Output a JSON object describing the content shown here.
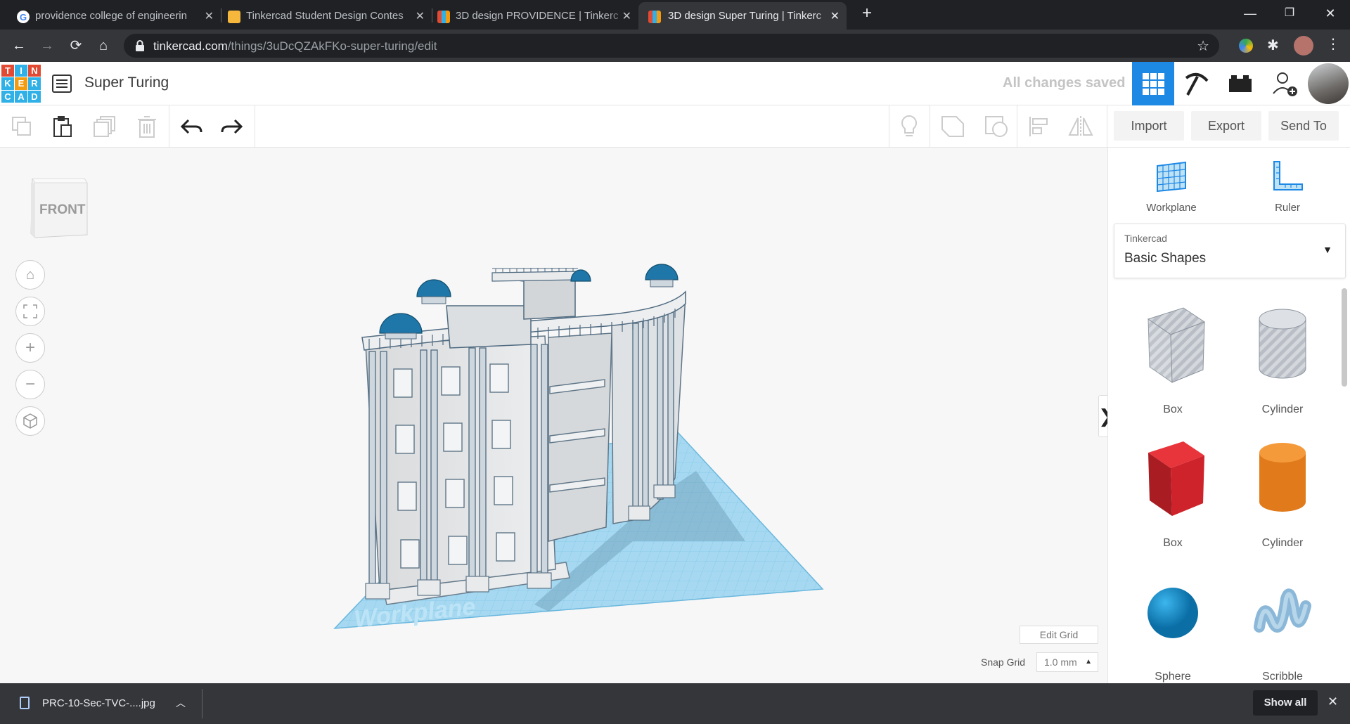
{
  "browser": {
    "tabs": [
      {
        "title": "providence college of engineerin",
        "active": false
      },
      {
        "title": "Tinkercad Student Design Contes",
        "active": false
      },
      {
        "title": "3D design PROVIDENCE | Tinkerc",
        "active": false
      },
      {
        "title": "3D design Super Turing | Tinkerc",
        "active": true
      }
    ],
    "url_host": "tinkercad.com",
    "url_path": "/things/3uDcQZAkFKo-super-turing/edit"
  },
  "header": {
    "logo_letters": [
      "T",
      "I",
      "N",
      "K",
      "E",
      "R",
      "C",
      "A",
      "D"
    ],
    "logo_colors": [
      "#e24a33",
      "#2fb0e6",
      "#e24a33",
      "#2fb0e6",
      "#f39c12",
      "#2fb0e6",
      "#2fb0e6",
      "#2fb0e6",
      "#2fb0e6"
    ],
    "design_title": "Super Turing",
    "save_status": "All changes saved"
  },
  "toolbar": {
    "import_label": "Import",
    "export_label": "Export",
    "sendto_label": "Send To"
  },
  "viewport": {
    "viewcube_label": "FRONT",
    "workplane_watermark": "Workplane",
    "edit_grid_label": "Edit Grid",
    "snap_grid_label": "Snap Grid",
    "snap_grid_value": "1.0 mm"
  },
  "panel": {
    "workplane_label": "Workplane",
    "ruler_label": "Ruler",
    "library_source": "Tinkercad",
    "library_name": "Basic Shapes",
    "shapes": [
      {
        "name": "Box",
        "color": "#b9bec6",
        "kind": "box-hole"
      },
      {
        "name": "Cylinder",
        "color": "#b9bec6",
        "kind": "cyl-hole"
      },
      {
        "name": "Box",
        "color": "#d0262d",
        "kind": "box"
      },
      {
        "name": "Cylinder",
        "color": "#e87c1e",
        "kind": "cyl"
      },
      {
        "name": "Sphere",
        "color": "#1a8ecb",
        "kind": "sphere"
      },
      {
        "name": "Scribble",
        "color": "#8bb8d8",
        "kind": "scribble"
      }
    ]
  },
  "downloads": {
    "file_name": "PRC-10-Sec-TVC-....jpg",
    "show_all_label": "Show all"
  }
}
